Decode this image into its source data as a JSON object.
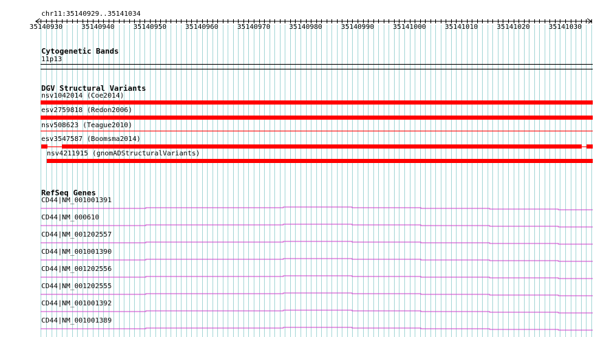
{
  "ruler": {
    "location": "chr11:35140929..35141034",
    "ticks": [
      "35140930",
      "35140940",
      "35140950",
      "35140960",
      "35140970",
      "35140980",
      "35140990",
      "35141000",
      "35141010",
      "35141020",
      "35141030"
    ]
  },
  "cytoband": {
    "title": "Cytogenetic Bands",
    "band": "11p13"
  },
  "dgv": {
    "title": "DGV Structural Variants",
    "variants": [
      "nsv1042014 (Coe2014)",
      "esv2759818 (Redon2006)",
      "nsv508623 (Teague2010)",
      "esv3547587 (Boomsma2014)",
      "nsv4211915 (gnomADStructuralVariants)"
    ]
  },
  "refseq": {
    "title": "RefSeq Genes",
    "genes": [
      "CD44|NM_001001391",
      "CD44|NM_000610",
      "CD44|NM_001202557",
      "CD44|NM_001001390",
      "CD44|NM_001202556",
      "CD44|NM_001202555",
      "CD44|NM_001001392",
      "CD44|NM_001001389"
    ]
  },
  "colors": {
    "grid": "#a8d8d8",
    "variant": "#ff0000",
    "gene": "#cc44cc"
  }
}
